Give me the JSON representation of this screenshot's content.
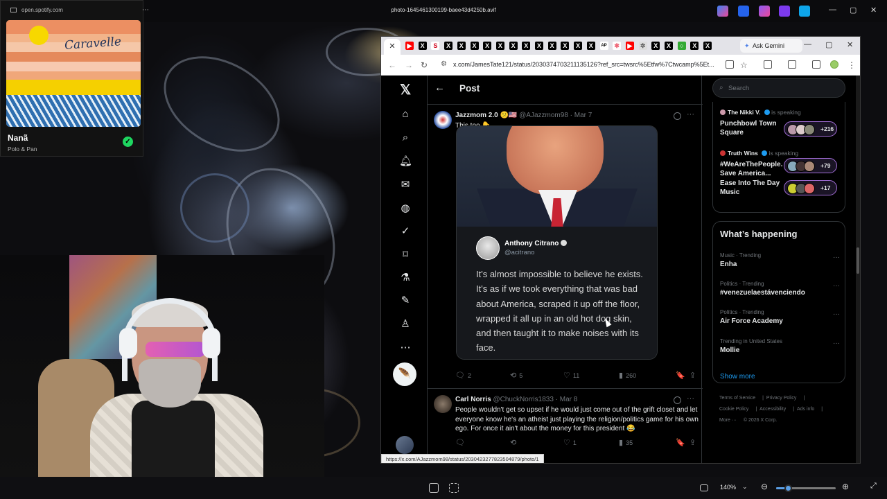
{
  "viewer": {
    "title": "photo-1645461300199-baee43d4250b.avif",
    "zoom": "140%",
    "zoom_fraction": 0.2,
    "controls": {
      "minimize": "—",
      "maximize": "▢",
      "close": "✕"
    }
  },
  "spotify": {
    "url": "open.spotify.com",
    "menu": "⋯",
    "track": "Nanã",
    "artist": "Polo & Pan",
    "cover_text": "Caravelle",
    "saved_icon": "✓"
  },
  "browser": {
    "active_tab_close": "✕",
    "new_tab": "+",
    "ask_gemini": "Ask Gemini",
    "url": "x.com/JamesTate121/status/2030374703211135126?ref_src=twsrc%5Etfw%7Ctwcamp%5Et...",
    "status_url": "https://x.com/AJazzmom98/status/2030423277823504879/photo/1",
    "window_controls": {
      "minimize": "—",
      "maximize": "▢",
      "close": "✕"
    },
    "tab_favicons": [
      "youtube",
      "x",
      "s",
      "x",
      "x",
      "x",
      "x",
      "x",
      "x",
      "x",
      "x",
      "x",
      "x",
      "x",
      "x",
      "ap",
      "multi",
      "youtube",
      "gear",
      "x",
      "x",
      "chrome-green",
      "x",
      "x"
    ]
  },
  "x": {
    "header": {
      "title": "Post",
      "back": "←"
    },
    "nav_icons": [
      "x-logo-icon",
      "home-icon",
      "explore-icon",
      "notifications-icon",
      "messages-icon",
      "grok-icon",
      "verified-icon",
      "bookmarks-icon",
      "premium-icon",
      "lists-icon",
      "profile-icon",
      "more-icon"
    ],
    "post_button": "🪶",
    "tweets": [
      {
        "name": "Jazzmom 2.0 😕🇺🇸",
        "handle": "@AJazzmom98 · Mar 7",
        "text": "This too 👇",
        "quote": {
          "name": "Anthony Citrano",
          "handle": "@acitrano",
          "text": "It's almost impossible to believe he exists. It's as if we took everything that was bad about America, scraped it up off the floor, wrapped it all up in an old hot dog skin, and then taught it to make noises with its face."
        },
        "replies": "2",
        "reposts": "5",
        "likes": "11",
        "views": "260"
      },
      {
        "name": "Carl Norris",
        "handle": "@ChuckNorris1833 · Mar 8",
        "text": "People wouldn't get so upset if he would just come out of the grift closet and let everyone know he's an atheist just playing the religion/politics game for his own ego. For once it ain't about the money for this president 😂",
        "replies": "",
        "reposts": "",
        "likes": "1",
        "views": "35"
      }
    ],
    "search_placeholder": "Search",
    "spaces": [
      {
        "host": "The Nikki V.",
        "status": "is speaking",
        "title": "Punchbowl Town Square",
        "count": "+216"
      },
      {
        "host": "Truth Wins",
        "status": "is speaking",
        "title": "#WeAreThePeople. Save America...",
        "count": "+79"
      },
      {
        "host": "",
        "status": "",
        "title": "Ease Into The Day Music",
        "count": "+17"
      }
    ],
    "whats_happening": {
      "title": "What’s happening",
      "trends": [
        {
          "meta": "Music · Trending",
          "name": "Enha"
        },
        {
          "meta": "Politics · Trending",
          "name": "#venezuelaestávenciendo"
        },
        {
          "meta": "Politics · Trending",
          "name": "Air Force Academy"
        },
        {
          "meta": "Trending in United States",
          "name": "Mollie"
        }
      ],
      "show_more": "Show more"
    },
    "footer": {
      "terms": "Terms of Service",
      "privacy": "Privacy Policy",
      "cookie": "Cookie Policy",
      "accessibility": "Accessibility",
      "ads": "Ads info",
      "more": "More ···",
      "copyright": "© 2026 X Corp."
    }
  }
}
